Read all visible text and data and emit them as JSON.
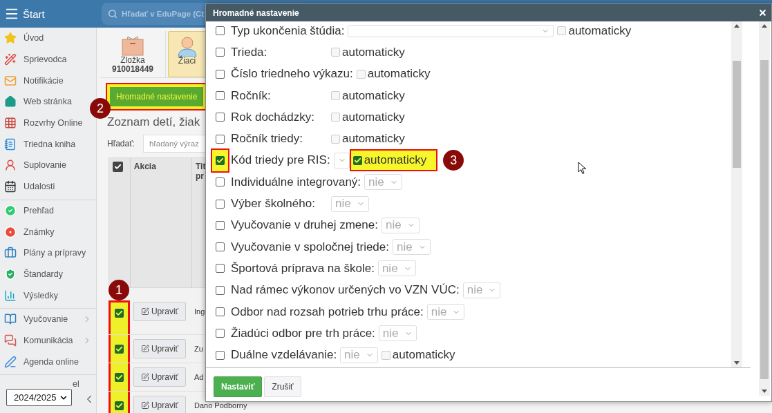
{
  "topbar": {
    "title": "Štart",
    "search": {
      "placeholder": "Hľadať v EduPage (Ct"
    }
  },
  "sidebar": {
    "groups": [
      [
        {
          "label": "Úvod",
          "expandable": false
        },
        {
          "label": "Sprievodca",
          "expandable": false
        },
        {
          "label": "Notifikácie",
          "expandable": false
        },
        {
          "label": "Web stránka",
          "expandable": false
        },
        {
          "label": "Rozvrhy Online",
          "expandable": false
        },
        {
          "label": "Triedna kniha",
          "expandable": false
        },
        {
          "label": "Suplovanie",
          "expandable": false
        },
        {
          "label": "Udalosti",
          "expandable": false
        }
      ],
      [
        {
          "label": "Prehľad",
          "expandable": false
        },
        {
          "label": "Známky",
          "expandable": false
        },
        {
          "label": "Plány a prípravy",
          "expandable": false
        },
        {
          "label": "Štandardy",
          "expandable": false
        },
        {
          "label": "Výsledky",
          "expandable": false
        }
      ],
      [
        {
          "label": "Vyučovanie",
          "expandable": true
        },
        {
          "label": "Komunikácia",
          "expandable": true
        },
        {
          "label": "Agenda online",
          "expandable": false
        }
      ]
    ],
    "partial_item": "el",
    "year": "2024/2025"
  },
  "tiles": [
    {
      "label": "Zložka",
      "sublabel": "910018449",
      "selected": false
    },
    {
      "label": "Žiaci",
      "selected": true
    }
  ],
  "bulk_button": {
    "label": "Hromadné nastavenie",
    "highlighted": true,
    "badge": "2"
  },
  "heading": "Zoznam detí, žiak",
  "search": {
    "label": "Hľadať:",
    "placeholder": "hľadaný výraz"
  },
  "table": {
    "header_checked": true,
    "columns": [
      "Akcia",
      "Tit pr"
    ],
    "highlighted": true,
    "badge": "1",
    "rows": [
      {
        "checked": true,
        "action": "Upraviť",
        "name": "Ing"
      },
      {
        "checked": true,
        "action": "Upraviť",
        "name": "Zu"
      },
      {
        "checked": true,
        "action": "Upraviť",
        "name": "Ad"
      },
      {
        "checked": true,
        "action": "Upraviť",
        "name": "Dano Podborny"
      }
    ]
  },
  "dialog": {
    "title": "Hromadné nastavenie",
    "items": [
      {
        "label": "Typ ukončenia štúdia:",
        "checked": false,
        "highlighted": false,
        "select": {
          "kind": "wide"
        },
        "auto": {
          "label": "automaticky",
          "checked": false,
          "highlighted": false
        }
      },
      {
        "label": "Trieda:",
        "checked": false,
        "highlighted": false,
        "auto": {
          "label": "automaticky",
          "checked": false,
          "highlighted": false
        }
      },
      {
        "label": "Číslo triedneho výkazu:",
        "checked": false,
        "highlighted": false,
        "auto": {
          "label": "automaticky",
          "checked": false,
          "highlighted": false
        }
      },
      {
        "label": "Ročník:",
        "checked": false,
        "highlighted": false,
        "auto": {
          "label": "automaticky",
          "checked": false,
          "highlighted": false
        }
      },
      {
        "label": "Rok dochádzky:",
        "checked": false,
        "highlighted": false,
        "auto": {
          "label": "automaticky",
          "checked": false,
          "highlighted": false
        }
      },
      {
        "label": "Ročník triedy:",
        "checked": false,
        "highlighted": false,
        "auto": {
          "label": "automaticky",
          "checked": false,
          "highlighted": false
        }
      },
      {
        "label": "Kód triedy pre RIS:",
        "checked": true,
        "highlighted": true,
        "badge": "3",
        "select": {
          "kind": "narrow"
        },
        "auto": {
          "label": "automaticky",
          "checked": true,
          "highlighted": true
        }
      },
      {
        "label": "Individuálne integrovaný:",
        "checked": false,
        "highlighted": false,
        "select": {
          "kind": "normal",
          "value": "nie"
        }
      },
      {
        "label": "Výber školného:",
        "checked": false,
        "highlighted": false,
        "select": {
          "kind": "normal",
          "value": "nie"
        }
      },
      {
        "label": "Vyučovanie v druhej zmene:",
        "checked": false,
        "highlighted": false,
        "select": {
          "kind": "normal",
          "value": "nie"
        }
      },
      {
        "label": "Vyučovanie v spoločnej triede:",
        "checked": false,
        "highlighted": false,
        "select": {
          "kind": "normal",
          "value": "nie"
        }
      },
      {
        "label": "Športová príprava na škole:",
        "checked": false,
        "highlighted": false,
        "select": {
          "kind": "normal",
          "value": "nie"
        }
      },
      {
        "label": "Nad rámec výkonov určených vo VZN VÚC:",
        "checked": false,
        "highlighted": false,
        "select": {
          "kind": "normal",
          "value": "nie"
        }
      },
      {
        "label": "Odbor nad rozsah potrieb trhu práce:",
        "checked": false,
        "highlighted": false,
        "select": {
          "kind": "normal",
          "value": "nie"
        }
      },
      {
        "label": "Žiadúci odbor pre trh práce:",
        "checked": false,
        "highlighted": false,
        "select": {
          "kind": "normal",
          "value": "nie"
        }
      },
      {
        "label": "Duálne vzdelávanie:",
        "checked": false,
        "highlighted": false,
        "select": {
          "kind": "normal",
          "value": "nie"
        },
        "auto": {
          "label": "automaticky",
          "checked": false,
          "highlighted": false
        }
      }
    ],
    "buttons": [
      {
        "label": "Nastaviť",
        "kind": "primary"
      },
      {
        "label": "Zrušiť",
        "kind": "default"
      }
    ]
  }
}
